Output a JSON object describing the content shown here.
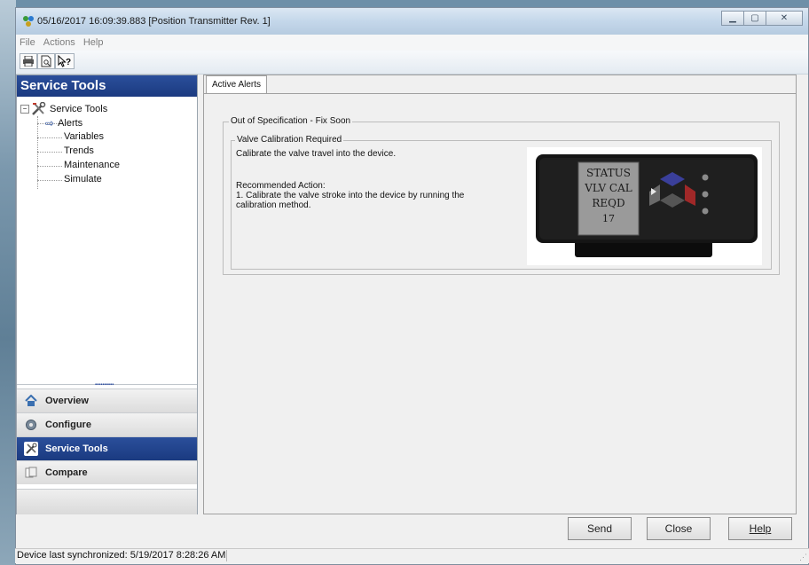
{
  "window": {
    "title": "05/16/2017 16:09:39.883 [Position Transmitter Rev. 1]",
    "controls": [
      "minimize",
      "maximize",
      "close"
    ]
  },
  "menu": [
    "File",
    "Actions",
    "Help"
  ],
  "toolbar": {
    "icons": [
      "printer-icon",
      "print-preview-icon",
      "context-help-icon"
    ]
  },
  "left_panel": {
    "header": "Service Tools",
    "tree": {
      "root": "Service Tools",
      "children": [
        "Alerts",
        "Variables",
        "Trends",
        "Maintenance",
        "Simulate"
      ],
      "selected": "Alerts"
    },
    "nav": [
      {
        "label": "Overview",
        "icon": "home-icon"
      },
      {
        "label": "Configure",
        "icon": "gear-icon"
      },
      {
        "label": "Service Tools",
        "icon": "tools-icon",
        "active": true
      },
      {
        "label": "Compare",
        "icon": "compare-icon"
      }
    ]
  },
  "main": {
    "tab": "Active Alerts",
    "group_title": "Out of Specification - Fix Soon",
    "alert": {
      "title": "Valve Calibration Required",
      "description": "Calibrate the valve travel into the device.",
      "rec_heading": "Recommended Action:",
      "rec_line1": "1. Calibrate the valve stroke into the device by running the",
      "rec_line2": "calibration method.",
      "display_lines": [
        "STATUS",
        "VLV CAL",
        "REQD",
        "17"
      ]
    }
  },
  "buttons": {
    "send": "Send",
    "close": "Close",
    "help": "Help"
  },
  "status": {
    "text": "Device last synchronized: 5/19/2017 8:28:26 AM"
  },
  "colors": {
    "header_blue": "#1f4290",
    "accent": "#2b4f9b"
  }
}
